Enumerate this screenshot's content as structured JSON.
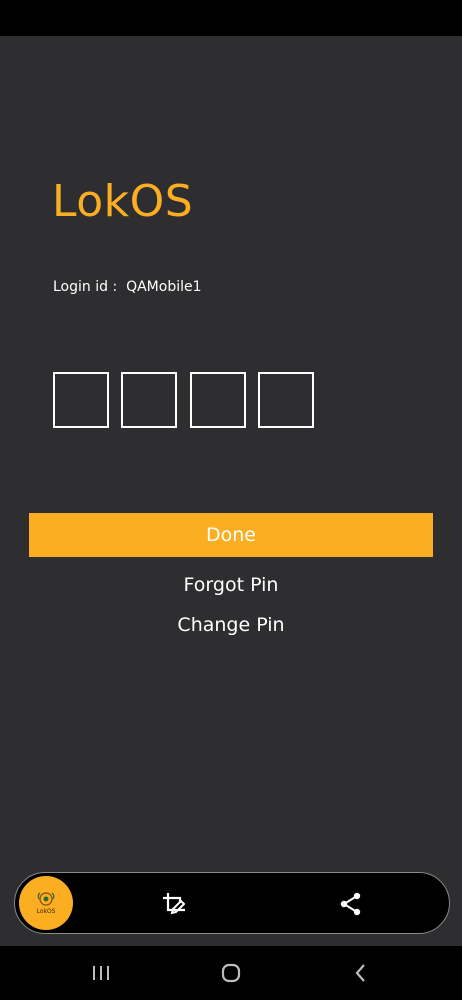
{
  "app": {
    "title": "LokOS"
  },
  "login": {
    "label": "Login id :",
    "value": "QAMobile1"
  },
  "pin": {
    "box_count": 4,
    "values": [
      "",
      "",
      "",
      ""
    ]
  },
  "actions": {
    "done_label": "Done",
    "forgot_pin_label": "Forgot Pin",
    "change_pin_label": "Change Pin"
  },
  "screenshot_toolbar": {
    "badge_text": "LokOS",
    "icons": [
      "app-badge-icon",
      "crop-edit-icon",
      "share-icon"
    ]
  },
  "system_nav": {
    "icons": [
      "recent-apps-icon",
      "home-icon",
      "back-icon"
    ]
  },
  "colors": {
    "accent": "#fbae22",
    "background": "#2e2d2f",
    "text": "#ffffff"
  }
}
